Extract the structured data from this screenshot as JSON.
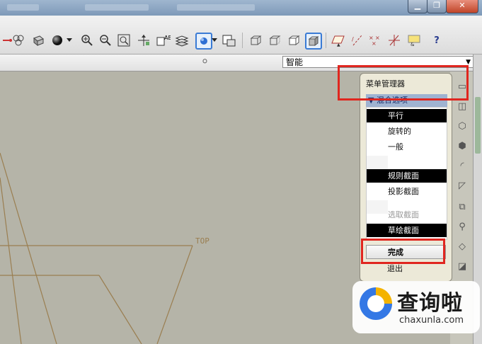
{
  "window": {
    "minimize_glyph": "▁",
    "restore_glyph": "❐",
    "close_glyph": "✕"
  },
  "toolbar": {
    "icons": [
      "sketch-line-icon",
      "palette-icon",
      "shaded-box-icon",
      "sphere-icon",
      "zoom-in-icon",
      "zoom-out-icon",
      "refit-icon",
      "move-icon",
      "annotation-icon",
      "layer-icon",
      "view-manager-icon",
      "saved-views-icon",
      "wireframe-icon",
      "hidden-line-icon",
      "no-hidden-icon",
      "shading-icon",
      "datum-plane-icon",
      "datum-axis-icon",
      "datum-point-icon",
      "coord-sys-icon",
      "annotation-display-icon",
      "help-icon"
    ],
    "help_glyph": "?"
  },
  "filter": {
    "selected": "智能"
  },
  "canvas": {
    "datum_label": "TOP",
    "line_color": "#9a7e50"
  },
  "menu": {
    "title": "菜单管理器",
    "section": "混合选项",
    "items": [
      {
        "label": "平行",
        "state": "selected"
      },
      {
        "label": "旋转的",
        "state": "normal"
      },
      {
        "label": "一般",
        "state": "normal"
      },
      {
        "label": "规则截面",
        "state": "selected"
      },
      {
        "label": "投影截面",
        "state": "normal"
      },
      {
        "label": "选取截面",
        "state": "disabled"
      },
      {
        "label": "草绘截面",
        "state": "selected"
      }
    ],
    "done_label": "完成",
    "exit_label": "退出"
  },
  "watermark": {
    "brand_cn": "查询啦",
    "brand_en": "chaxunla.com"
  },
  "colors": {
    "highlight": "#e0261f",
    "selected_bg": "#000000",
    "header_bg": "#9fb3d1",
    "canvas_bg": "#b5b4a8"
  }
}
